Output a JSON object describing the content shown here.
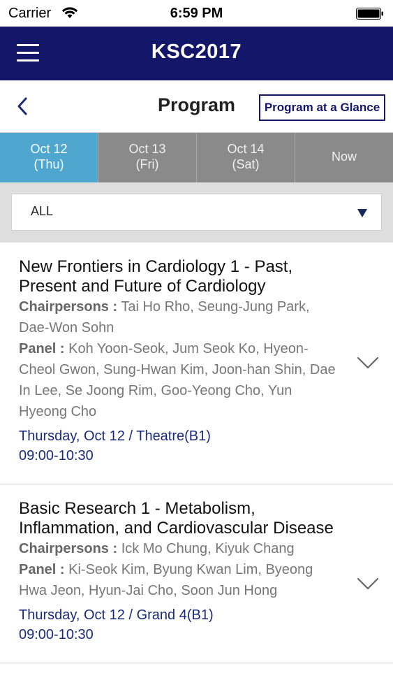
{
  "status_bar": {
    "carrier": "Carrier",
    "time": "6:59 PM"
  },
  "app_bar": {
    "title": "KSC2017",
    "menu_icon": "hamburger-menu-icon",
    "bg_color": "#14166a"
  },
  "sub_header": {
    "title": "Program",
    "glance_button": "Program at a Glance",
    "back_icon": "chevron-left-icon"
  },
  "tabs": [
    {
      "line1": "Oct 12",
      "line2": "(Thu)",
      "active": true
    },
    {
      "line1": "Oct 13",
      "line2": "(Fri)",
      "active": false
    },
    {
      "line1": "Oct 14",
      "line2": "(Sat)",
      "active": false
    },
    {
      "line1": "Now",
      "line2": "",
      "active": false
    }
  ],
  "accent_color": "#4fa7d0",
  "filter": {
    "selected": "ALL"
  },
  "sessions": [
    {
      "title": "New Frontiers in Cardiology 1 - Past, Present and Future of Cardiology",
      "chair_label": "Chairpersons :",
      "chairpersons": " Tai Ho Rho, Seung-Jung Park, Dae-Won Sohn",
      "panel_label": "Panel :",
      "panel": " Koh Yoon-Seok, Jum Seok Ko, Hyeon-Cheol Gwon, Sung-Hwan Kim, Joon-han Shin, Dae In Lee, Se Joong Rim, Goo-Yeong Cho, Yun Hyeong Cho",
      "date_place": "Thursday, Oct 12 / Theatre(B1)",
      "time": "09:00-10:30"
    },
    {
      "title": "Basic Research 1 - Metabolism, Inflammation, and Cardiovascular Disease",
      "chair_label": "Chairpersons :",
      "chairpersons": " Ick Mo Chung, Kiyuk Chang",
      "panel_label": "Panel :",
      "panel": " Ki-Seok Kim, Byung Kwan Lim, Byeong Hwa Jeon, Hyun-Jai Cho, Soon Jun Hong",
      "date_place": "Thursday, Oct 12 / Grand 4(B1)",
      "time": "09:00-10:30"
    }
  ]
}
